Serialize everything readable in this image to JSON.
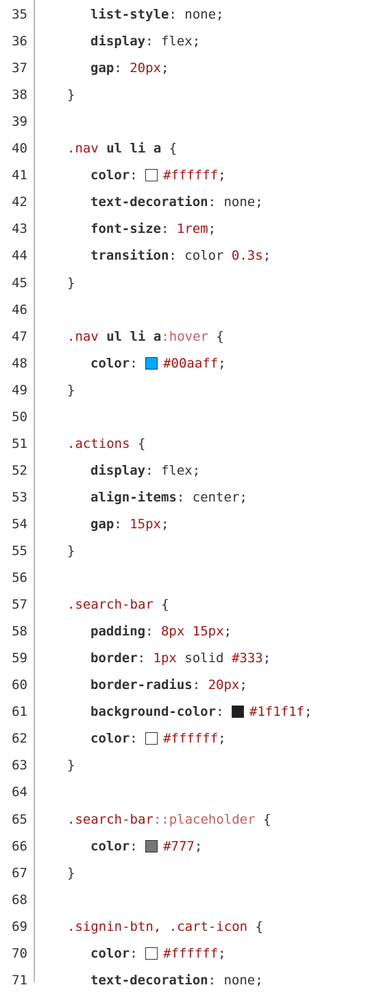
{
  "lines": [
    {
      "n": "35",
      "type": "decl",
      "prop": "list-style",
      "val": "none",
      "kind": "plain"
    },
    {
      "n": "36",
      "type": "decl",
      "prop": "display",
      "val": "flex",
      "kind": "plain"
    },
    {
      "n": "37",
      "type": "decl",
      "prop": "gap",
      "val": "20px",
      "kind": "num"
    },
    {
      "n": "38",
      "type": "close"
    },
    {
      "n": "39",
      "type": "blank"
    },
    {
      "n": "40",
      "type": "sel",
      "parts": [
        {
          "t": ".nav ",
          "c": "sel"
        },
        {
          "t": "ul",
          "c": "kw"
        },
        {
          "t": " ",
          "c": "val"
        },
        {
          "t": "li",
          "c": "kw"
        },
        {
          "t": " ",
          "c": "val"
        },
        {
          "t": "a",
          "c": "kw"
        },
        {
          "t": " {",
          "c": "brace"
        }
      ]
    },
    {
      "n": "41",
      "type": "decl",
      "prop": "color",
      "val": "#ffffff",
      "kind": "color",
      "swatch": "#ffffff"
    },
    {
      "n": "42",
      "type": "decl",
      "prop": "text-decoration",
      "val": "none",
      "kind": "plain"
    },
    {
      "n": "43",
      "type": "decl",
      "prop": "font-size",
      "val": "1rem",
      "kind": "num"
    },
    {
      "n": "44",
      "type": "decl-mixed",
      "prop": "transition",
      "parts": [
        {
          "t": "color ",
          "c": "val"
        },
        {
          "t": "0.3s",
          "c": "num"
        },
        {
          "t": ";",
          "c": "val"
        }
      ]
    },
    {
      "n": "45",
      "type": "close"
    },
    {
      "n": "46",
      "type": "blank"
    },
    {
      "n": "47",
      "type": "sel",
      "parts": [
        {
          "t": ".nav ",
          "c": "sel"
        },
        {
          "t": "ul",
          "c": "kw"
        },
        {
          "t": " ",
          "c": "val"
        },
        {
          "t": "li",
          "c": "kw"
        },
        {
          "t": " ",
          "c": "val"
        },
        {
          "t": "a",
          "c": "kw"
        },
        {
          "t": ":hover",
          "c": "pseudo"
        },
        {
          "t": " {",
          "c": "brace"
        }
      ]
    },
    {
      "n": "48",
      "type": "decl",
      "prop": "color",
      "val": "#00aaff",
      "kind": "color",
      "swatch": "#00aaff"
    },
    {
      "n": "49",
      "type": "close"
    },
    {
      "n": "50",
      "type": "blank"
    },
    {
      "n": "51",
      "type": "sel",
      "parts": [
        {
          "t": ".actions",
          "c": "sel"
        },
        {
          "t": " {",
          "c": "brace"
        }
      ]
    },
    {
      "n": "52",
      "type": "decl",
      "prop": "display",
      "val": "flex",
      "kind": "plain"
    },
    {
      "n": "53",
      "type": "decl",
      "prop": "align-items",
      "val": "center",
      "kind": "plain"
    },
    {
      "n": "54",
      "type": "decl",
      "prop": "gap",
      "val": "15px",
      "kind": "num"
    },
    {
      "n": "55",
      "type": "close"
    },
    {
      "n": "56",
      "type": "blank"
    },
    {
      "n": "57",
      "type": "sel",
      "parts": [
        {
          "t": ".search-bar",
          "c": "sel"
        },
        {
          "t": " {",
          "c": "brace"
        }
      ]
    },
    {
      "n": "58",
      "type": "decl-mixed",
      "prop": "padding",
      "parts": [
        {
          "t": "8px",
          "c": "num"
        },
        {
          "t": " ",
          "c": "val"
        },
        {
          "t": "15px",
          "c": "num"
        },
        {
          "t": ";",
          "c": "val"
        }
      ]
    },
    {
      "n": "59",
      "type": "decl-mixed",
      "prop": "border",
      "parts": [
        {
          "t": "1px",
          "c": "num"
        },
        {
          "t": " solid ",
          "c": "val"
        },
        {
          "t": "#333",
          "c": "hex"
        },
        {
          "t": ";",
          "c": "val"
        }
      ]
    },
    {
      "n": "60",
      "type": "decl",
      "prop": "border-radius",
      "val": "20px",
      "kind": "num"
    },
    {
      "n": "61",
      "type": "decl",
      "prop": "background-color",
      "val": "#1f1f1f",
      "kind": "color",
      "swatch": "#1f1f1f"
    },
    {
      "n": "62",
      "type": "decl",
      "prop": "color",
      "val": "#ffffff",
      "kind": "color",
      "swatch": "#ffffff"
    },
    {
      "n": "63",
      "type": "close"
    },
    {
      "n": "64",
      "type": "blank"
    },
    {
      "n": "65",
      "type": "sel",
      "parts": [
        {
          "t": ".search-bar",
          "c": "sel"
        },
        {
          "t": "::placeholder",
          "c": "pseudo"
        },
        {
          "t": " {",
          "c": "brace"
        }
      ]
    },
    {
      "n": "66",
      "type": "decl",
      "prop": "color",
      "val": "#777",
      "kind": "color",
      "swatch": "#777777"
    },
    {
      "n": "67",
      "type": "close"
    },
    {
      "n": "68",
      "type": "blank"
    },
    {
      "n": "69",
      "type": "sel",
      "parts": [
        {
          "t": ".signin-btn, .cart-icon",
          "c": "sel"
        },
        {
          "t": " {",
          "c": "brace"
        }
      ]
    },
    {
      "n": "70",
      "type": "decl",
      "prop": "color",
      "val": "#ffffff",
      "kind": "color",
      "swatch": "#ffffff"
    },
    {
      "n": "71",
      "type": "decl",
      "prop": "text-decoration",
      "val": "none",
      "kind": "plain"
    }
  ]
}
